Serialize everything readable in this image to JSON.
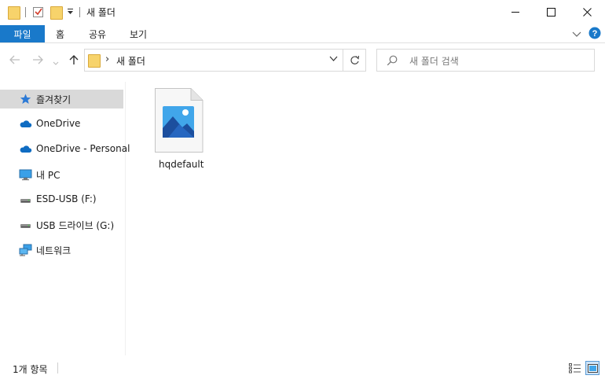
{
  "window": {
    "title": "새 폴더",
    "minimize_icon": "minimize-icon",
    "maximize_icon": "maximize-icon",
    "close_icon": "close-icon"
  },
  "ribbon": {
    "tabs": [
      {
        "label": "파일",
        "active": true
      },
      {
        "label": "홈"
      },
      {
        "label": "공유"
      },
      {
        "label": "보기"
      }
    ]
  },
  "address": {
    "path": "새 폴더",
    "search_placeholder": "새 폴더 검색"
  },
  "sidebar": {
    "items": [
      {
        "label": "즐겨찾기",
        "icon": "star-icon",
        "selected": true
      },
      {
        "label": "OneDrive",
        "icon": "cloud-icon"
      },
      {
        "label": "OneDrive - Personal",
        "icon": "cloud-icon"
      },
      {
        "label": "내 PC",
        "icon": "pc-icon"
      },
      {
        "label": "ESD-USB (F:)",
        "icon": "drive-icon"
      },
      {
        "label": "USB 드라이브 (G:)",
        "icon": "drive-icon"
      },
      {
        "label": "네트워크",
        "icon": "network-icon"
      }
    ]
  },
  "content": {
    "files": [
      {
        "name": "hqdefault",
        "icon": "image-file-icon"
      }
    ]
  },
  "status": {
    "item_count": "1개 항목"
  },
  "colors": {
    "accent": "#1979ca",
    "selection": "#d9d9d9",
    "folder": "#f7d36b"
  }
}
